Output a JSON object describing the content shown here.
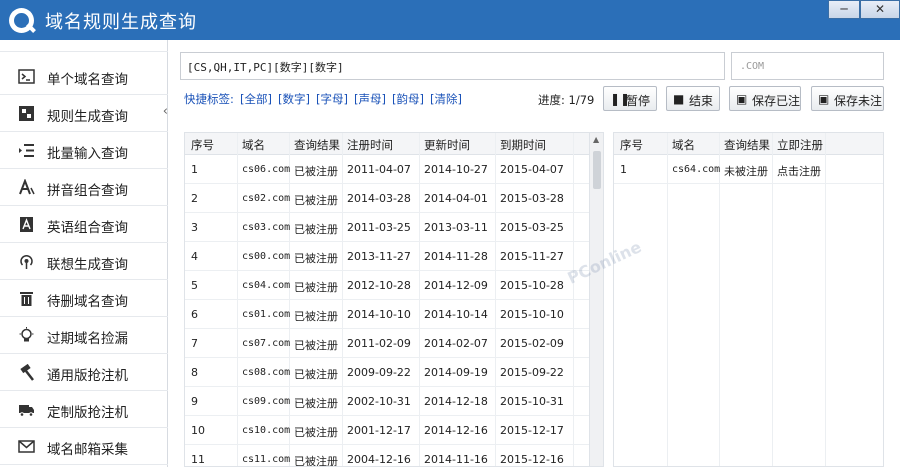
{
  "window": {
    "title": "域名规则生成查询",
    "min_label": "─",
    "close_label": "✕"
  },
  "sidebar": {
    "items": [
      {
        "label": "单个域名查询",
        "icon": "terminal-icon"
      },
      {
        "label": "规则生成查询",
        "icon": "grid-icon"
      },
      {
        "label": "批量输入查询",
        "icon": "list-indent-icon"
      },
      {
        "label": "拼音组合查询",
        "icon": "font-a-icon"
      },
      {
        "label": "英语组合查询",
        "icon": "dictionary-icon"
      },
      {
        "label": "联想生成查询",
        "icon": "signal-icon"
      },
      {
        "label": "待删域名查询",
        "icon": "trash-icon"
      },
      {
        "label": "过期域名捡漏",
        "icon": "lightbulb-icon"
      },
      {
        "label": "通用版抢注机",
        "icon": "hammer-icon"
      },
      {
        "label": "定制版抢注机",
        "icon": "truck-icon"
      },
      {
        "label": "域名邮箱采集",
        "icon": "envelope-icon"
      }
    ]
  },
  "toolbar": {
    "rule_value": "[CS,QH,IT,PC][数字][数字]",
    "suffix_placeholder": ".COM",
    "quick_label": "快捷标签:",
    "quick_tags": [
      "[全部]",
      "[数字]",
      "[字母]",
      "[声母]",
      "[韵母]",
      "[清除]"
    ],
    "progress": "进度: 1/79",
    "pause_label": "暂停",
    "stop_label": "结束",
    "save_registered_label": "保存已注",
    "save_unregistered_label": "保存未注"
  },
  "left_table": {
    "headers": [
      "序号",
      "域名",
      "查询结果",
      "注册时间",
      "更新时间",
      "到期时间"
    ],
    "rows": [
      [
        "1",
        "cs06.com",
        "已被注册",
        "2011-04-07",
        "2014-10-27",
        "2015-04-07"
      ],
      [
        "2",
        "cs02.com",
        "已被注册",
        "2014-03-28",
        "2014-04-01",
        "2015-03-28"
      ],
      [
        "3",
        "cs03.com",
        "已被注册",
        "2011-03-25",
        "2013-03-11",
        "2015-03-25"
      ],
      [
        "4",
        "cs00.com",
        "已被注册",
        "2013-11-27",
        "2014-11-28",
        "2015-11-27"
      ],
      [
        "5",
        "cs04.com",
        "已被注册",
        "2012-10-28",
        "2014-12-09",
        "2015-10-28"
      ],
      [
        "6",
        "cs01.com",
        "已被注册",
        "2014-10-10",
        "2014-10-14",
        "2015-10-10"
      ],
      [
        "7",
        "cs07.com",
        "已被注册",
        "2011-02-09",
        "2014-02-07",
        "2015-02-09"
      ],
      [
        "8",
        "cs08.com",
        "已被注册",
        "2009-09-22",
        "2014-09-19",
        "2015-09-22"
      ],
      [
        "9",
        "cs09.com",
        "已被注册",
        "2002-10-31",
        "2014-12-18",
        "2015-10-31"
      ],
      [
        "10",
        "cs10.com",
        "已被注册",
        "2001-12-17",
        "2014-12-16",
        "2015-12-17"
      ],
      [
        "11",
        "cs11.com",
        "已被注册",
        "2004-12-16",
        "2014-11-16",
        "2015-12-16"
      ]
    ]
  },
  "right_table": {
    "headers": [
      "序号",
      "域名",
      "查询结果",
      "立即注册"
    ],
    "rows": [
      [
        "1",
        "cs64.com",
        "未被注册",
        "点击注册"
      ]
    ]
  }
}
